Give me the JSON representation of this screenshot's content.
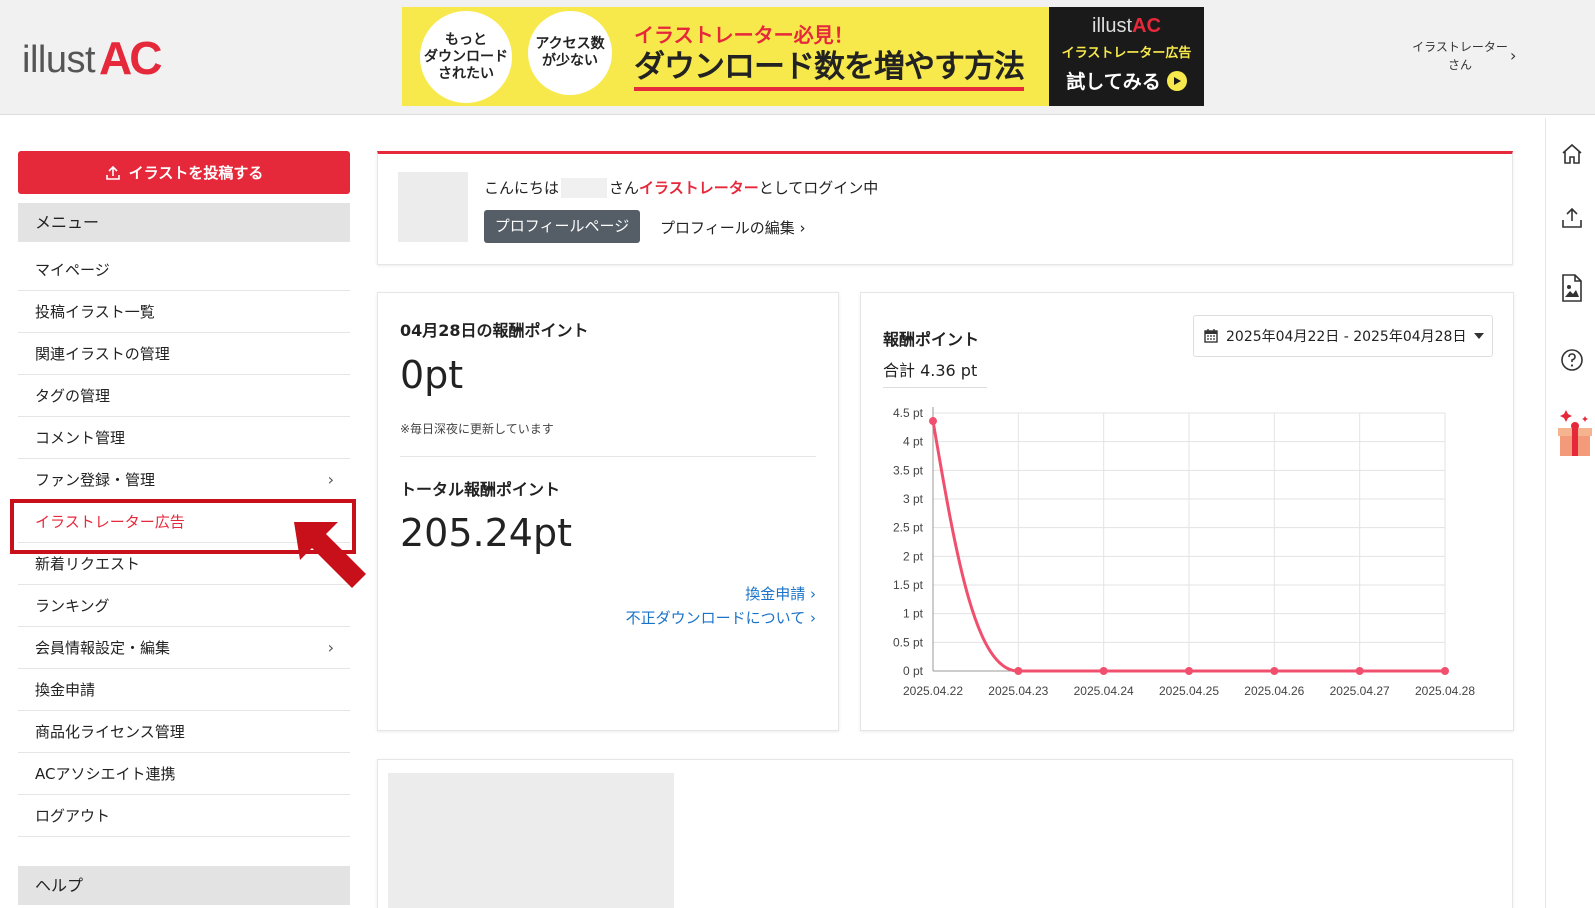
{
  "header": {
    "logo_illust": "illust",
    "logo_ac": "AC",
    "banner": {
      "bubble1": "もっと\nダウンロード\nされたい",
      "bubble2": "アクセス数\nが少ない",
      "subtitle": "イラストレーター必見！",
      "title": "ダウンロード数を増やす方法",
      "cta_logo_illust": "illust",
      "cta_logo_ac": "AC",
      "cta_label": "イラストレーター広告",
      "cta_try": "試してみる"
    },
    "user_line1": "イラストレーター",
    "user_line2": "さん"
  },
  "sidebar": {
    "post_button": "イラストを投稿する",
    "menu_header": "メニュー",
    "items": [
      {
        "label": "マイページ"
      },
      {
        "label": "投稿イラスト一覧"
      },
      {
        "label": "関連イラストの管理"
      },
      {
        "label": "タグの管理"
      },
      {
        "label": "コメント管理"
      },
      {
        "label": "ファン登録・管理"
      },
      {
        "label": "イラストレーター広告"
      },
      {
        "label": "新着リクエスト"
      },
      {
        "label": "ランキング"
      },
      {
        "label": "会員情報設定・編集"
      },
      {
        "label": "換金申請"
      },
      {
        "label": "商品化ライセンス管理"
      },
      {
        "label": "ACアソシエイト連携"
      },
      {
        "label": "ログアウト"
      }
    ],
    "help_header": "ヘルプ"
  },
  "welcome": {
    "greeting_prefix": "こんにちは",
    "greeting_san": "さん",
    "role": "イラストレーター",
    "greeting_suffix": "としてログイン中",
    "profile_button": "プロフィールページ",
    "profile_edit": "プロフィールの編集 ›"
  },
  "points": {
    "daily_title": "04月28日の報酬ポイント",
    "daily_value": "0pt",
    "note": "※毎日深夜に更新しています",
    "total_title": "トータル報酬ポイント",
    "total_value": "205.24pt",
    "link_exchange": "換金申請 ›",
    "link_fraud": "不正ダウンロードについて ›"
  },
  "chart_panel": {
    "title": "報酬ポイント",
    "total": "合計 4.36 pt",
    "date_range": "2025年04月22日 - 2025年04月28日"
  },
  "chart_data": {
    "type": "line",
    "x": [
      "2025.04.22",
      "2025.04.23",
      "2025.04.24",
      "2025.04.25",
      "2025.04.26",
      "2025.04.27",
      "2025.04.28"
    ],
    "series": [
      {
        "values": [
          4.36,
          0,
          0,
          0,
          0,
          0,
          0
        ],
        "color": "#f0506e"
      }
    ],
    "ylim": [
      0,
      4.5
    ],
    "yticks": [
      0,
      0.5,
      1,
      1.5,
      2,
      2.5,
      3,
      3.5,
      4,
      4.5
    ],
    "ytick_suffix": " pt",
    "grid": true,
    "smooth": true
  },
  "colors": {
    "brand_red": "#e6283b",
    "link_blue": "#1a73c9",
    "line_pink": "#f0506e"
  }
}
